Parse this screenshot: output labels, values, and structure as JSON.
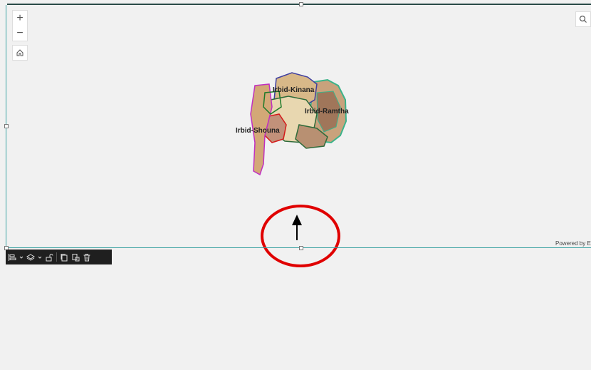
{
  "map": {
    "regions": [
      {
        "label": "Irbid-Kinana",
        "color": "#3f3fa0"
      },
      {
        "label": "Irbid-Ramtha",
        "color": "#3bb38a"
      },
      {
        "label": "Irbid-Shouna",
        "color": "#c02fc0"
      }
    ],
    "attribution": "Powered by Esri"
  },
  "controls": {
    "zoom_in": "+",
    "zoom_out": "−"
  },
  "toolbar": {
    "items": [
      "align-icon",
      "chevron-down-icon",
      "layers-icon",
      "chevron-down-icon",
      "unlock-icon",
      "duplicate-icon",
      "copy-style-icon",
      "trash-icon"
    ]
  },
  "annotation": {
    "circle_color": "#e00000",
    "arrow_color": "#000000"
  }
}
